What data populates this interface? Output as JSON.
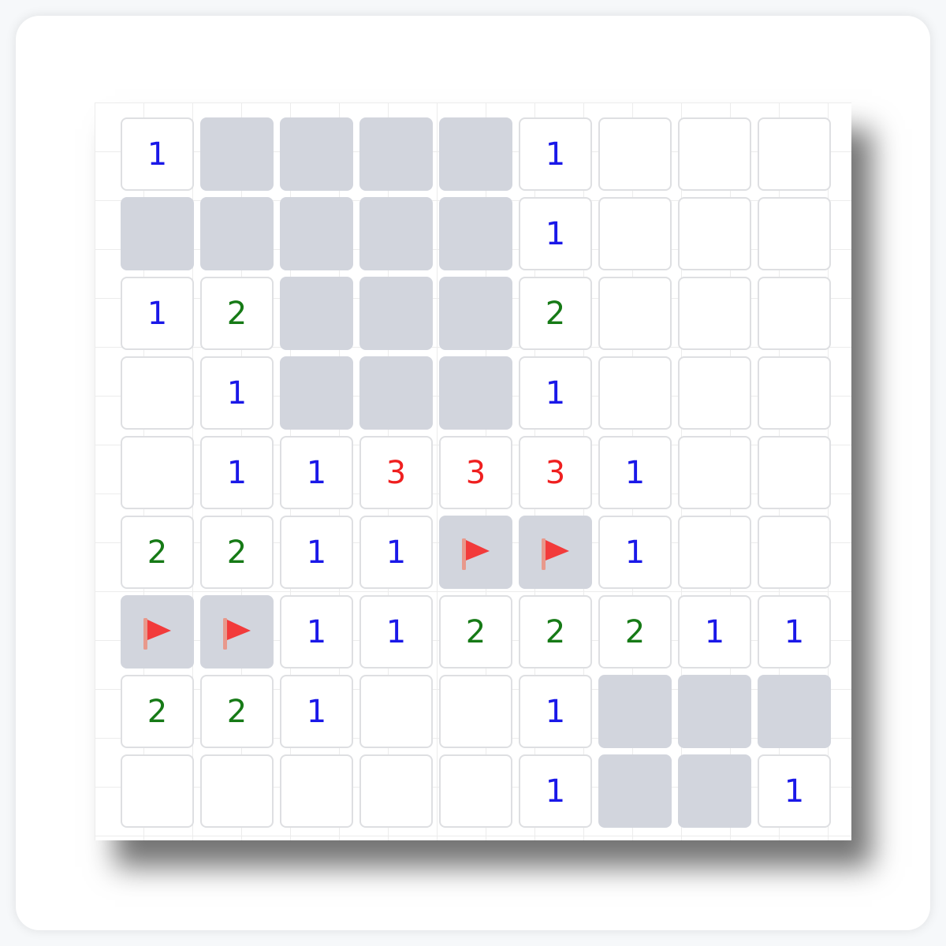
{
  "colors": {
    "n1": "#1a18e8",
    "n2": "#167a16",
    "n3": "#ef1f1f",
    "hidden_cell": "#d2d5dd",
    "revealed_cell": "#ffffff",
    "flag": "#f23b3b",
    "flag_pole": "#e8998c"
  },
  "board": {
    "rows": 9,
    "cols": 9,
    "cells": [
      [
        "1",
        "#",
        "#",
        "#",
        "#",
        "1",
        "",
        "",
        ""
      ],
      [
        "#",
        "#",
        "#",
        "#",
        "#",
        "1",
        "",
        "",
        ""
      ],
      [
        "1",
        "2",
        "#",
        "#",
        "#",
        "2",
        "",
        "",
        ""
      ],
      [
        "",
        "1",
        "#",
        "#",
        "#",
        "1",
        "",
        "",
        ""
      ],
      [
        "",
        "1",
        "1",
        "3",
        "3",
        "3",
        "1",
        "",
        ""
      ],
      [
        "2",
        "2",
        "1",
        "1",
        "F",
        "F",
        "1",
        "",
        ""
      ],
      [
        "F",
        "F",
        "1",
        "1",
        "2",
        "2",
        "2",
        "1",
        "1"
      ],
      [
        "2",
        "2",
        "1",
        "",
        "",
        "1",
        "#",
        "#",
        "#"
      ],
      [
        "",
        "",
        "",
        "",
        "",
        "1",
        "#",
        "#",
        "1"
      ]
    ],
    "legend": {
      "#": "hidden",
      "F": "flag-icon",
      "": "revealed-empty"
    }
  }
}
